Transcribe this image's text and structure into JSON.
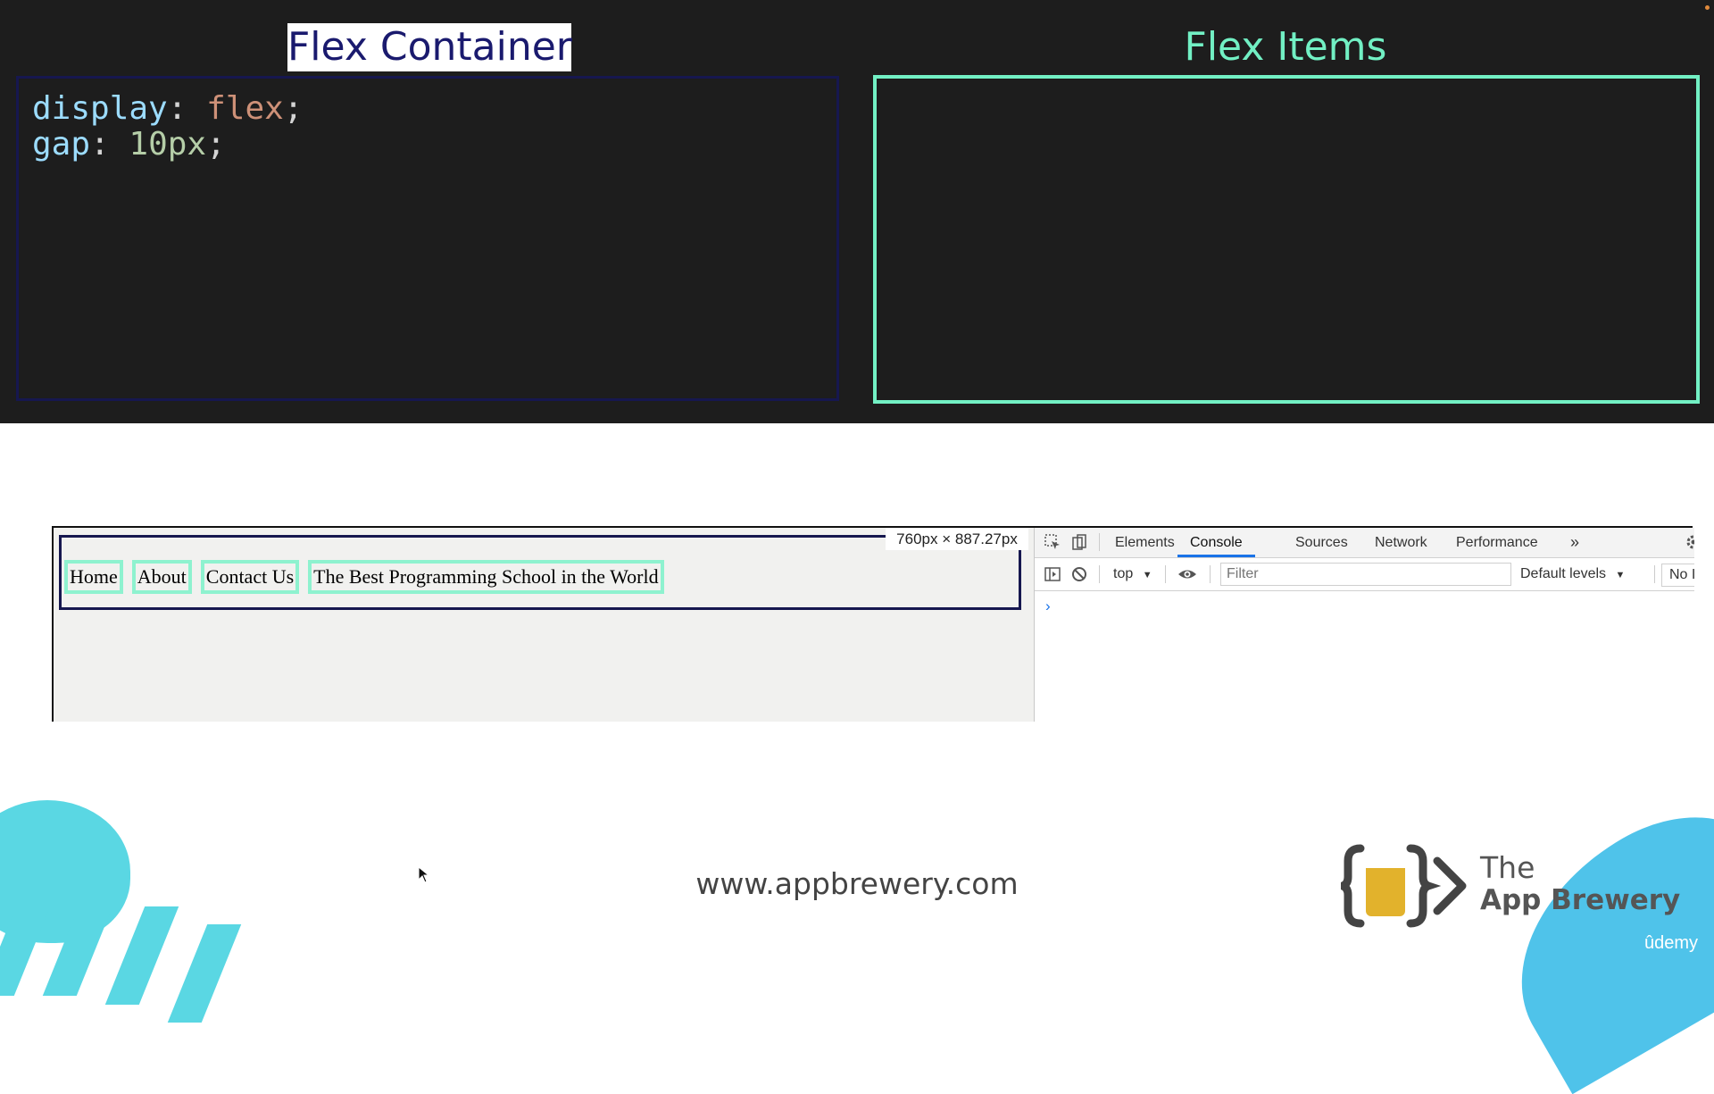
{
  "slide": {
    "container_title": "Flex Container",
    "items_title": "Flex Items",
    "code": {
      "line1_prop": "display",
      "line1_value": "flex",
      "line2_prop": "gap",
      "line2_value": "10px",
      "colon": ":",
      "semicolon": ";"
    }
  },
  "demo": {
    "nav_items": [
      "Home",
      "About",
      "Contact Us",
      "The Best Programming School in the World"
    ],
    "dimensions_tooltip": "760px × 887.27px"
  },
  "devtools": {
    "tabs": [
      "Elements",
      "Console",
      "Sources",
      "Network",
      "Performance"
    ],
    "active_tab": "Console",
    "more_tabs_icon": "»",
    "context": "top",
    "filter_placeholder": "Filter",
    "levels": "Default levels",
    "issues": "No Issu",
    "prompt": "›"
  },
  "footer": {
    "url": "www.appbrewery.com",
    "logo_line1": "The",
    "logo_line2": "App Brewery",
    "platform": "ûdemy"
  },
  "colors": {
    "container_accent": "#16174f",
    "items_accent": "#72f0c4",
    "brand_blue": "#5ad7e3"
  },
  "icons": [
    "inspect-icon",
    "device-toggle-icon",
    "settings-icon",
    "sidebar-icon",
    "clear-console-icon",
    "eye-icon",
    "cursor-icon",
    "app-brewery-logo-icon"
  ]
}
